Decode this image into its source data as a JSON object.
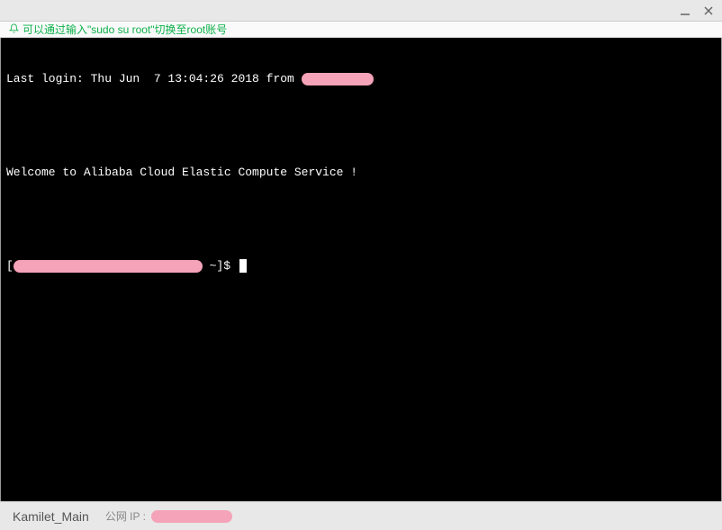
{
  "hint": {
    "text": "可以通过输入\"sudo su root\"切换至root账号"
  },
  "terminal": {
    "last_login_prefix": "Last login: Thu Jun  7 13:04:26 2018 from ",
    "welcome": "Welcome to Alibaba Cloud Elastic Compute Service !",
    "prompt_open": "[",
    "prompt_close": " ~]$ "
  },
  "statusbar": {
    "name": "Kamilet_Main",
    "ip_label": "公网 IP :"
  }
}
